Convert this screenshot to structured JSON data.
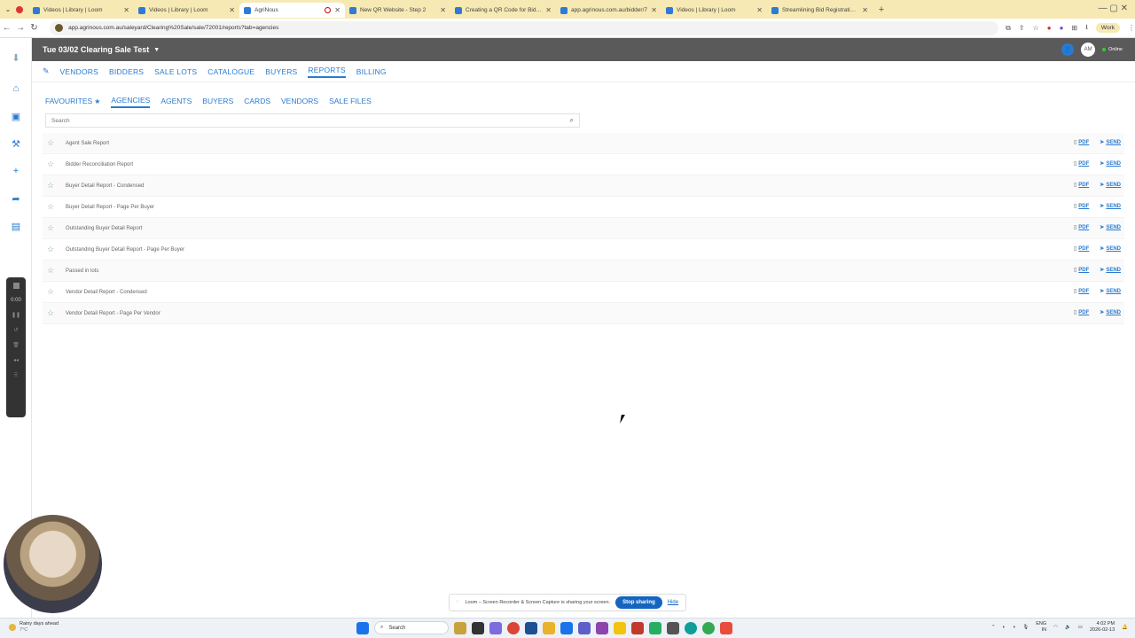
{
  "browser": {
    "tabs": [
      {
        "title": "Videos | Library | Loom",
        "active": false
      },
      {
        "title": "Videos | Library | Loom",
        "active": false
      },
      {
        "title": "AgriNous",
        "active": true
      },
      {
        "title": "New QR Website - Step 2",
        "active": false
      },
      {
        "title": "Creating a QR Code for Bidde",
        "active": false
      },
      {
        "title": "app.agrinous.com.au/bidder/7",
        "active": false
      },
      {
        "title": "Videos | Library | Loom",
        "active": false
      },
      {
        "title": "Streamlining Bid Registrations",
        "active": false
      }
    ],
    "new_tab": "+",
    "url": "app.agrinous.com.au/saleyard/Clearing%20Sale/sale/72001/reports?tab=agencies",
    "profile_label": "Work"
  },
  "header": {
    "sale_title": "Tue 03/02 Clearing Sale Test",
    "user_initials": "AM",
    "status": "Online"
  },
  "main_nav": {
    "items": [
      "VENDORS",
      "BIDDERS",
      "SALE LOTS",
      "CATALOGUE",
      "BUYERS",
      "REPORTS",
      "BILLING"
    ],
    "active": "REPORTS"
  },
  "sub_nav": {
    "items": [
      "FAVOURITES",
      "AGENCIES",
      "AGENTS",
      "BUYERS",
      "CARDS",
      "VENDORS",
      "SALE FILES"
    ],
    "active": "AGENCIES"
  },
  "search": {
    "placeholder": "Search"
  },
  "reports": [
    "Agent Sale Report",
    "Bidder Reconciliation Report",
    "Buyer Detail Report - Condensed",
    "Buyer Detail Report - Page Per Buyer",
    "Outstanding Buyer Detail Report",
    "Outstanding Buyer Detail Report - Page Per Buyer",
    "Passed in lots",
    "Vendor Detail Report - Condensed",
    "Vendor Detail Report - Page Per Vendor"
  ],
  "row_actions": {
    "pdf": "PDF",
    "send": "SEND"
  },
  "recorder": {
    "time": "0:00"
  },
  "loom_banner": {
    "message": "Loom – Screen Recorder & Screen Capture is sharing your screen.",
    "stop": "Stop sharing",
    "hide": "Hide"
  },
  "taskbar": {
    "weather_title": "Rainy days ahead",
    "weather_temp": "7°C",
    "search": "Search",
    "lang_top": "ENG",
    "lang_bottom": "IN",
    "time": "4:02 PM",
    "date": "2026-02-13"
  },
  "colors": {
    "accent": "#2a7bd0",
    "header_bg": "#5a5a5a",
    "tabbar_bg": "#f6e9b3",
    "stop_button": "#1565c0"
  }
}
